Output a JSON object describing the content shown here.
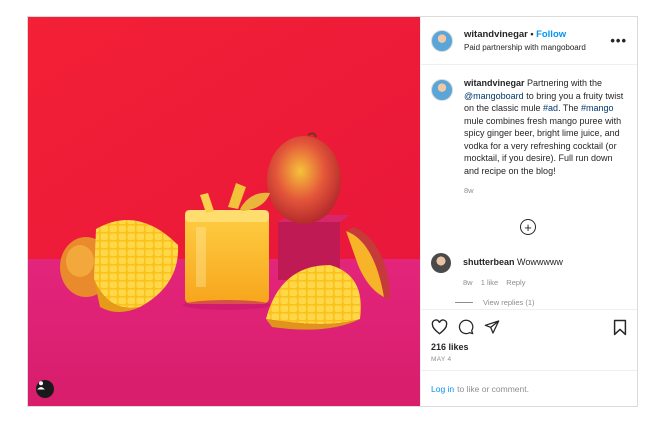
{
  "post": {
    "username": "witandvinegar",
    "separator": "•",
    "follow_label": "Follow",
    "partnership": "Paid partnership with mangoboard",
    "more_label": "•••"
  },
  "caption": {
    "username": "witandvinegar",
    "text_1": " Partnering with the ",
    "mention": "@mangoboard",
    "text_2": " to bring you a fruity twist on the classic mule ",
    "hashtag_1": "#ad",
    "text_3": ". The ",
    "hashtag_2": "#mango",
    "text_4": " mule combines fresh mango puree with spicy ginger beer, bright lime juice, and vodka for a very refreshing cocktail (or mocktail, if you desire). Full run down and recipe on the blog!",
    "time": "8w"
  },
  "load_more_label": "+",
  "comment": {
    "username": "shutterbean",
    "text": " Wowwwww",
    "time": "8w",
    "likes": "1 like",
    "reply_label": "Reply"
  },
  "view_replies": "View replies (1)",
  "stats": {
    "likes": "216 likes",
    "date": "MAY 4"
  },
  "footer": {
    "login_label": "Log in",
    "rest": "to like or comment."
  },
  "icons": {
    "like": "heart-icon",
    "comment": "comment-bubble-icon",
    "share": "paper-plane-icon",
    "save": "bookmark-icon",
    "tag": "user-tag-icon"
  },
  "colors": {
    "background_red": "#f0203a",
    "surface_magenta": "#e8227a",
    "link_blue": "#0095f6",
    "mention_navy": "#00376b"
  }
}
